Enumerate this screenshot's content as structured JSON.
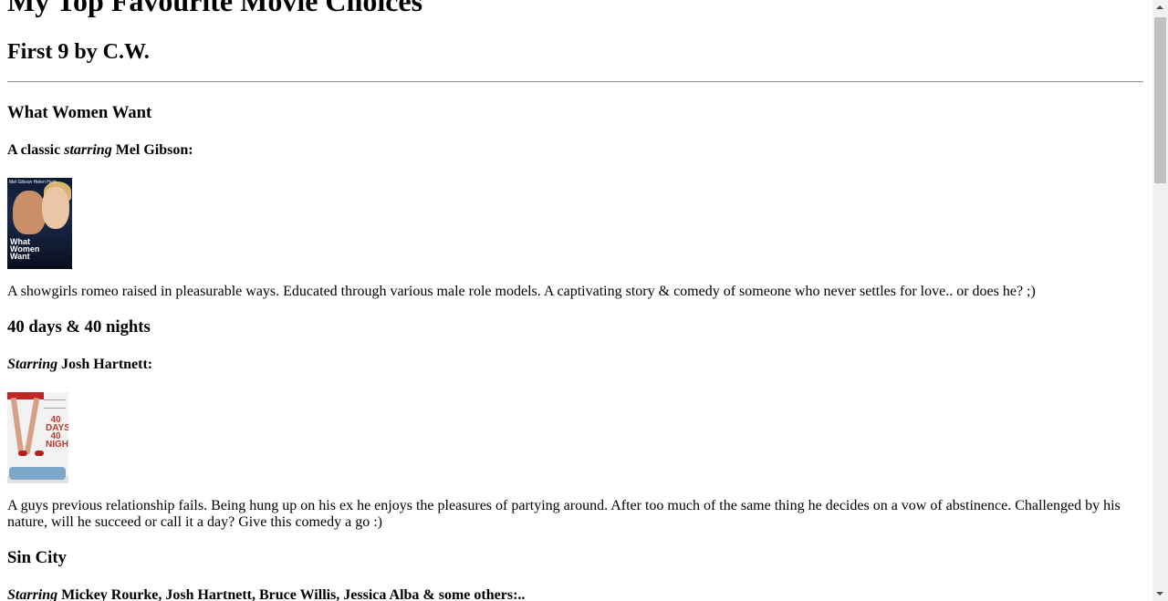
{
  "page": {
    "title": "My Top Favourite Movie Choices",
    "subtitle": "First 9 by C.W."
  },
  "movies": [
    {
      "title": "What Women Want",
      "tagline": {
        "pre": "A classic ",
        "em": "starring",
        "post": " Mel Gibson:"
      },
      "poster": {
        "names": "Mel Gibson   Helen Hunt",
        "title": "What Women Want"
      },
      "description": "A showgirls romeo raised in pleasurable ways. Educated through various male role models. A captivating story & comedy of someone who never settles for love.. or does he? ;)"
    },
    {
      "title": "40 days & 40 nights",
      "tagline": {
        "pre": "",
        "em": "Starring",
        "post": " Josh Hartnett:"
      },
      "poster": {
        "title": "40 DAYS 40 NIGHTS"
      },
      "description": "A guys previous relationship fails. Being hung up on his ex he enjoys the pleasures of partying around. After too much of the same thing he decides on a vow of abstinence. Challenged by his nature, will he succeed or call it a day? Give this comedy a go :)"
    },
    {
      "title": "Sin City",
      "tagline": {
        "pre": "",
        "em": "Starring",
        "post": " Mickey Rourke, Josh Hartnett, Bruce Willis, Jessica Alba & some others:.."
      }
    }
  ],
  "scrollbar": {
    "position_fraction": 0.0
  }
}
